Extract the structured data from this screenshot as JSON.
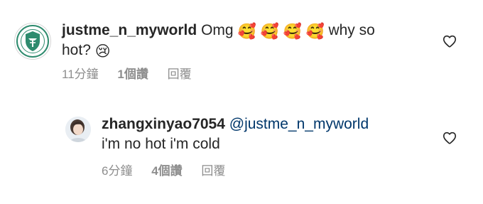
{
  "comments": [
    {
      "username": "justme_n_myworld",
      "text_before_emoji": "Omg",
      "emojis": [
        "🥰",
        "🥰",
        "🥰",
        "🥰"
      ],
      "text_after_emoji": "why so",
      "text_line2": "hot?",
      "end_emoji": "😢",
      "time": "11分鐘",
      "likes": "1個讚",
      "reply": "回覆"
    },
    {
      "username": "zhangxinyao7054",
      "mention": "@justme_n_myworld",
      "text_line2": "i'm no hot i'm cold",
      "time": "6分鐘",
      "likes": "4個讚",
      "reply": "回覆"
    }
  ],
  "colors": {
    "text": "#262626",
    "secondary": "#8e8e8e",
    "mention": "#00376b",
    "badge_green": "#2e8b6e"
  },
  "icons": {
    "like": "heart-outline-icon",
    "avatar_1": "shield-badge-logo",
    "avatar_2": "profile-photo"
  }
}
